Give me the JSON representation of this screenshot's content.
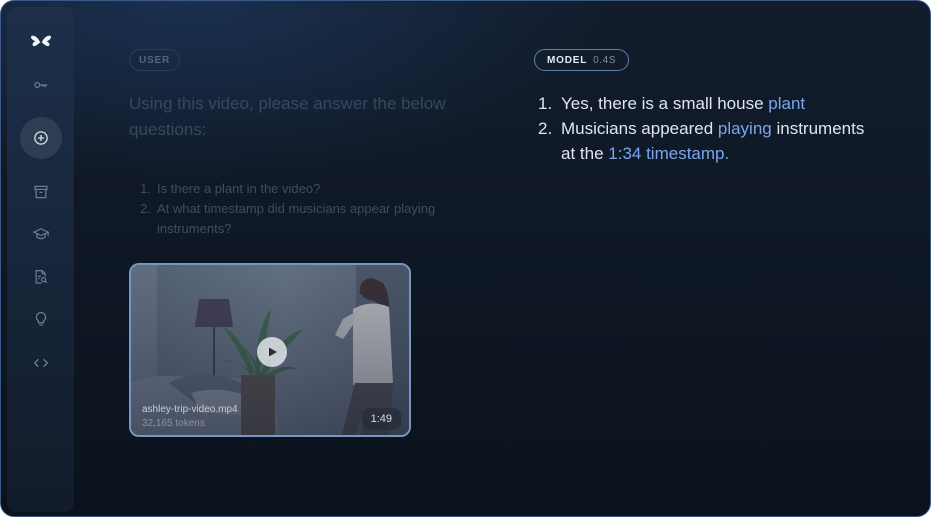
{
  "sidebar": {
    "items": [
      {
        "icon": "butterfly-logo-icon"
      },
      {
        "icon": "key-icon"
      },
      {
        "icon": "add-circle-icon",
        "active": true
      },
      {
        "icon": "archive-icon"
      },
      {
        "icon": "school-icon"
      },
      {
        "icon": "document-search-icon"
      },
      {
        "icon": "lightbulb-icon"
      },
      {
        "icon": "code-icon"
      }
    ]
  },
  "user": {
    "role_label": "USER",
    "prompt": "Using this video, please answer the below questions:",
    "questions": [
      {
        "num": "1.",
        "text": "Is there a plant in the video?"
      },
      {
        "num": "2.",
        "text": "At what timestamp did musicians appear playing instruments?"
      }
    ],
    "video": {
      "file_name": "ashley-trip-video.mp4",
      "tokens": "32,165 tokens",
      "duration": "1:49"
    }
  },
  "model": {
    "role_label": "MODEL",
    "time": "0.4S",
    "answers": [
      {
        "num": "1.",
        "text_plain": "Yes, there is a small house ",
        "text_highlight": "plant"
      },
      {
        "num": "2.",
        "text_plain_1": "Musicians appeared ",
        "text_highlight_1": "playing",
        "text_plain_2": " instruments at the ",
        "text_highlight_2": "1:34 timestamp."
      }
    ]
  },
  "colors": {
    "background": "#0f1826",
    "highlight": "#7aa7ec",
    "model_chip_border": "#5d7fb2"
  }
}
